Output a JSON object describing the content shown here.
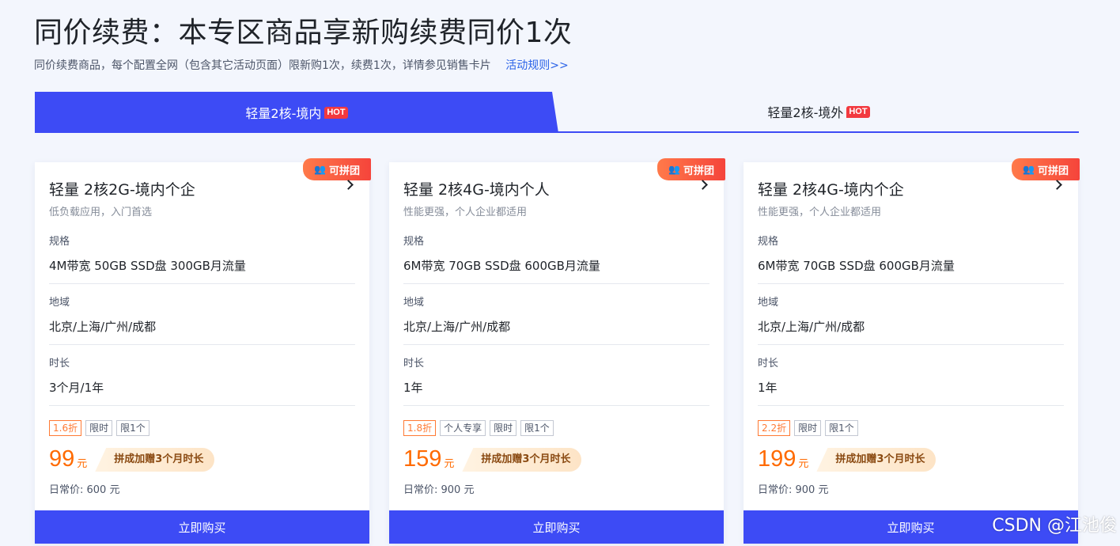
{
  "header": {
    "title": "同价续费：本专区商品享新购续费同价1次",
    "subtitle": "同价续费商品，每个配置全网（包含其它活动页面）限新购1次，续费1次，详情参见销售卡片",
    "rules_link": "活动规则>>"
  },
  "tabs": [
    {
      "label": "轻量2核-境内",
      "badge": "HOT",
      "active": true
    },
    {
      "label": "轻量2核-境外",
      "badge": "HOT",
      "active": false
    }
  ],
  "labels": {
    "spec": "规格",
    "region": "地域",
    "duration": "时长",
    "unit": "元",
    "buy": "立即购买"
  },
  "cards": [
    {
      "corner_tag": "可拼团",
      "title": "轻量 2核2G-境内个企",
      "desc": "低负载应用，入门首选",
      "spec": "4M带宽 50GB SSD盘 300GB月流量",
      "region": "北京/上海/广州/成都",
      "duration": "3个月/1年",
      "tags": [
        "1.6折",
        "限时",
        "限1个"
      ],
      "price": "99",
      "promo": "拼成加赠3个月时长",
      "original": "日常价: 600 元"
    },
    {
      "corner_tag": "可拼团",
      "title": "轻量 2核4G-境内个人",
      "desc": "性能更强，个人企业都适用",
      "spec": "6M带宽 70GB SSD盘 600GB月流量",
      "region": "北京/上海/广州/成都",
      "duration": "1年",
      "tags": [
        "1.8折",
        "个人专享",
        "限时",
        "限1个"
      ],
      "price": "159",
      "promo": "拼成加赠3个月时长",
      "original": "日常价: 900 元"
    },
    {
      "corner_tag": "可拼团",
      "title": "轻量 2核4G-境内个企",
      "desc": "性能更强，个人企业都适用",
      "spec": "6M带宽 70GB SSD盘 600GB月流量",
      "region": "北京/上海/广州/成都",
      "duration": "1年",
      "tags": [
        "2.2折",
        "限时",
        "限1个"
      ],
      "price": "199",
      "promo": "拼成加赠3个月时长",
      "original": "日常价: 900 元"
    }
  ],
  "watermark": "CSDN @江池俊",
  "colors": {
    "accent": "#3d4bf5",
    "hot": "#f2393f",
    "price": "#ff6a00",
    "link": "#2b63e8"
  }
}
